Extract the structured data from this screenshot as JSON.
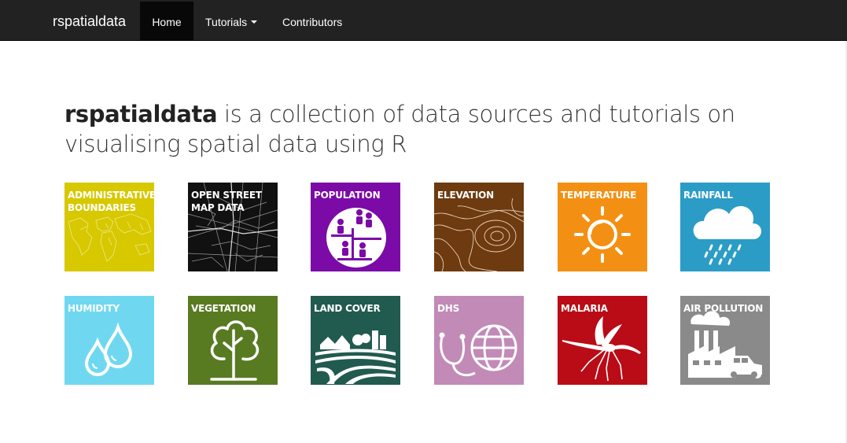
{
  "nav": {
    "brand": "rspatialdata",
    "items": [
      {
        "label": "Home",
        "active": true
      },
      {
        "label": "Tutorials",
        "dropdown": true
      },
      {
        "label": "Contributors"
      }
    ]
  },
  "headline": {
    "brand": "rspatialdata",
    "line1_rest": " is a collection of data sources and tutorials on",
    "line2": "visualising spatial data using R"
  },
  "tiles": [
    {
      "label": "ADMINISTRATIVE\nBOUNDARIES",
      "color": "#d7c800",
      "icon": "world-map-icon"
    },
    {
      "label": "OPEN STREET\nMAP DATA",
      "color": "#111111",
      "icon": "street-map-icon"
    },
    {
      "label": "POPULATION",
      "color": "#7b0aa7",
      "icon": "population-icon"
    },
    {
      "label": "ELEVATION",
      "color": "#6e3a10",
      "icon": "contour-lines-icon"
    },
    {
      "label": "TEMPERATURE",
      "color": "#f39013",
      "icon": "sun-icon"
    },
    {
      "label": "RAINFALL",
      "color": "#2b9cc6",
      "icon": "rain-cloud-icon"
    },
    {
      "label": "HUMIDITY",
      "color": "#6fd8f0",
      "icon": "water-drops-icon"
    },
    {
      "label": "VEGETATION",
      "color": "#587b22",
      "icon": "tree-icon"
    },
    {
      "label": "LAND COVER",
      "color": "#215a4f",
      "icon": "landscape-icon"
    },
    {
      "label": "DHS",
      "color": "#c28ab7",
      "icon": "stethoscope-globe-icon"
    },
    {
      "label": "MALARIA",
      "color": "#b90c16",
      "icon": "mosquito-icon"
    },
    {
      "label": "AIR POLLUTION",
      "color": "#8a8a8a",
      "icon": "factory-pollution-icon"
    }
  ]
}
